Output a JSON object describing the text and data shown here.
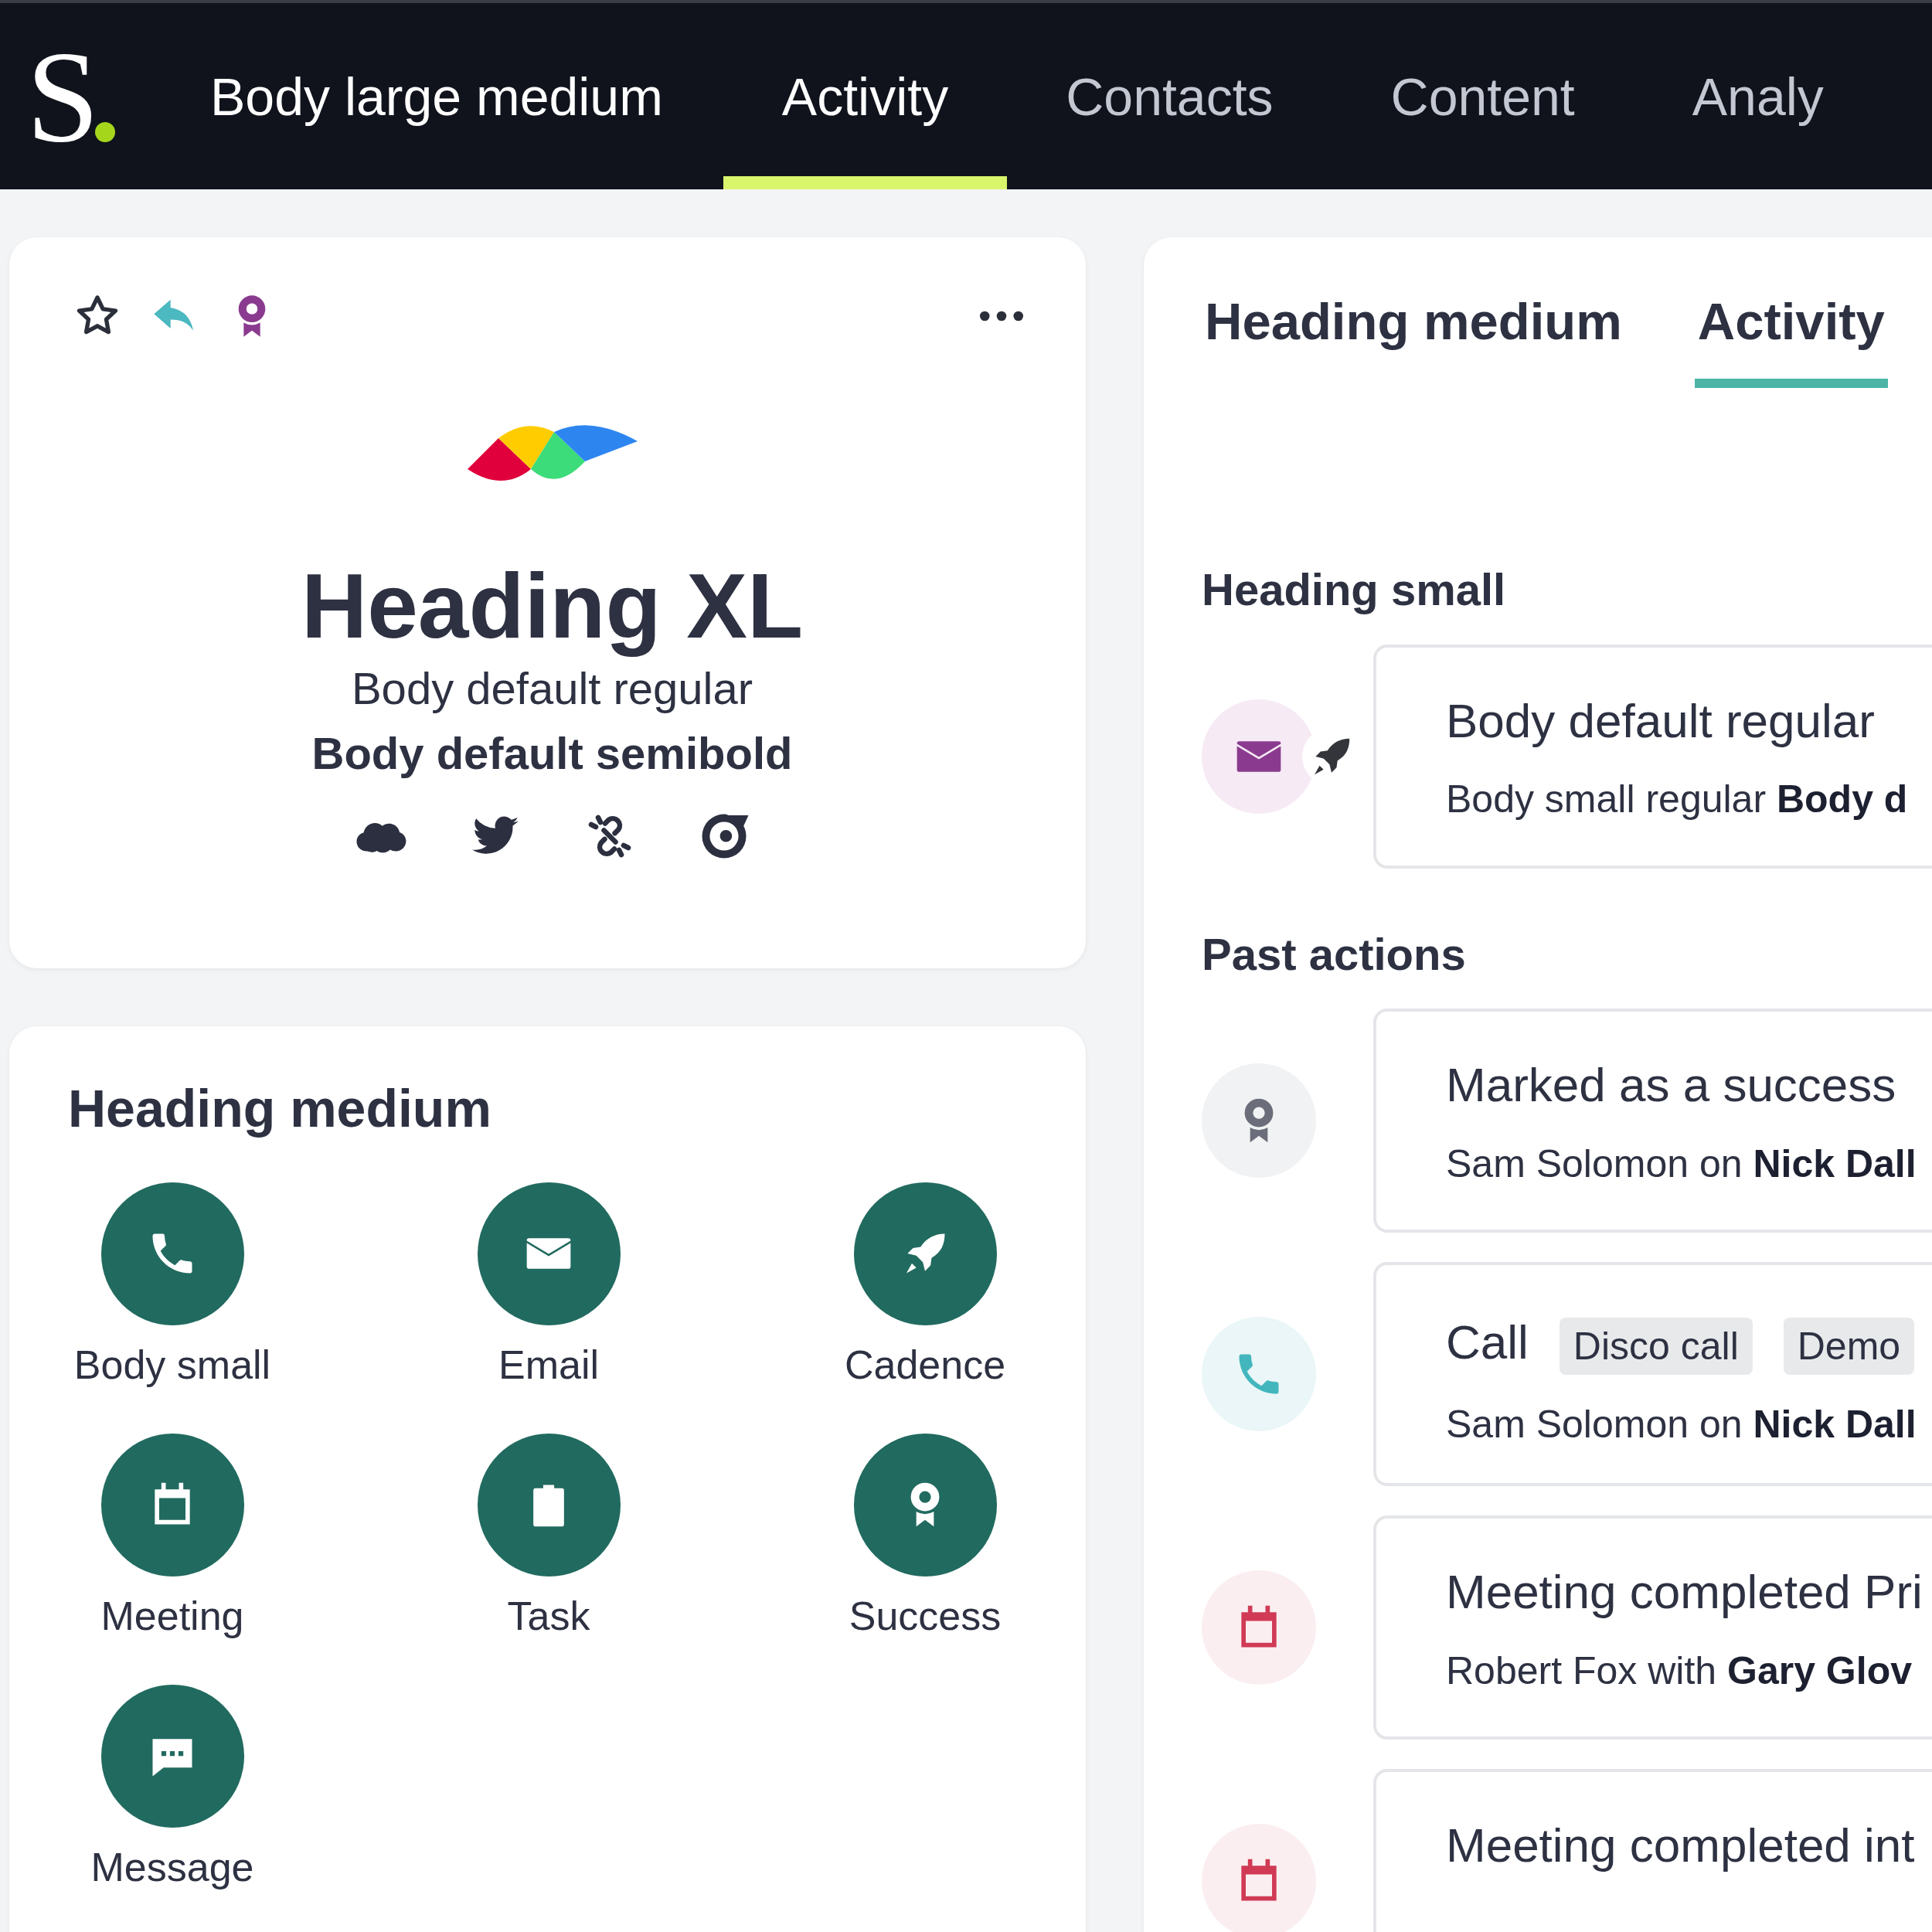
{
  "nav": {
    "logo": "S",
    "title": "Body large medium",
    "tabs": [
      {
        "label": "Activity",
        "selected": true
      },
      {
        "label": "Contacts",
        "selected": false
      },
      {
        "label": "Content",
        "selected": false
      },
      {
        "label": "Analy",
        "selected": false
      }
    ]
  },
  "profile_card": {
    "heading": "Heading XL",
    "subtitle": "Body default regular",
    "subtitle_strong": "Body default semibold"
  },
  "actions_card": {
    "heading": "Heading medium",
    "actions": [
      {
        "label": "Body small",
        "kind": "call"
      },
      {
        "label": "Email",
        "kind": "email"
      },
      {
        "label": "Cadence",
        "kind": "cadence"
      },
      {
        "label": "Meeting",
        "kind": "meeting"
      },
      {
        "label": "Task",
        "kind": "task"
      },
      {
        "label": "Success",
        "kind": "success"
      },
      {
        "label": "Message",
        "kind": "message"
      }
    ]
  },
  "activity_panel": {
    "tabs": [
      {
        "label": "Heading medium",
        "selected": false
      },
      {
        "label": "Activity",
        "selected": true
      }
    ],
    "upcoming": {
      "heading": "Heading small",
      "items": [
        {
          "kind": "email",
          "badges": [
            {
              "kind": "cadence"
            }
          ],
          "title": "Body default regular",
          "detail": "Body small regular **Body d**"
        }
      ]
    },
    "past": {
      "heading": "Past actions",
      "items": [
        {
          "kind": "success",
          "title": "Marked as a success",
          "detail": "Sam Solomon on **Nick Dall**"
        },
        {
          "kind": "call",
          "title": "Call",
          "tags": [
            "Disco call",
            "Demo"
          ],
          "detail": "Sam Solomon on **Nick Dall**"
        },
        {
          "kind": "meeting",
          "title": "Meeting completed Pri",
          "detail": "Robert Fox with **Gary Glov**"
        },
        {
          "kind": "meeting",
          "title": "Meeting completed int"
        }
      ]
    }
  }
}
